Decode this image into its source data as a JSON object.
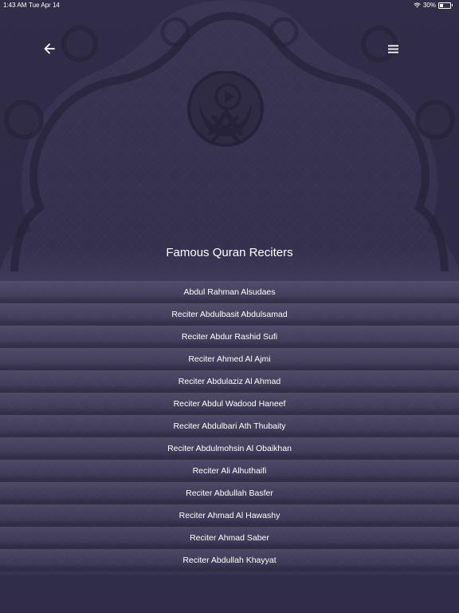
{
  "status_bar": {
    "time": "1:43 AM",
    "date": "Tue Apr 14",
    "battery_percent": "30%",
    "battery_level": 0.3,
    "icons": [
      "wifi-icon",
      "battery-icon"
    ]
  },
  "header": {
    "back_icon": "arrow-left-icon",
    "menu_icon": "hamburger-menu-icon",
    "logo_icon": "quran-play-logo-icon"
  },
  "page_title": "Famous Quran Reciters",
  "reciters": [
    "Abdul Rahman Alsudaes",
    "Reciter Abdulbasit Abdulsamad",
    "Reciter Abdur Rashid Sufi",
    "Reciter Ahmed Al Ajmi",
    "Reciter Abdulaziz Al Ahmad",
    "Reciter Abdul Wadood Haneef",
    "Reciter Abdulbari Ath Thubaity",
    "Reciter Abdulmohsin Al Obaikhan",
    "Reciter Ali Alhuthaifi",
    "Reciter Abdullah Basfer",
    "Reciter Ahmad Al Hawashy",
    "Reciter Ahmad Saber",
    "Reciter Abdullah Khayyat"
  ],
  "colors": {
    "background": "#35304d",
    "pattern": "#24213a",
    "text": "#ffffff"
  }
}
